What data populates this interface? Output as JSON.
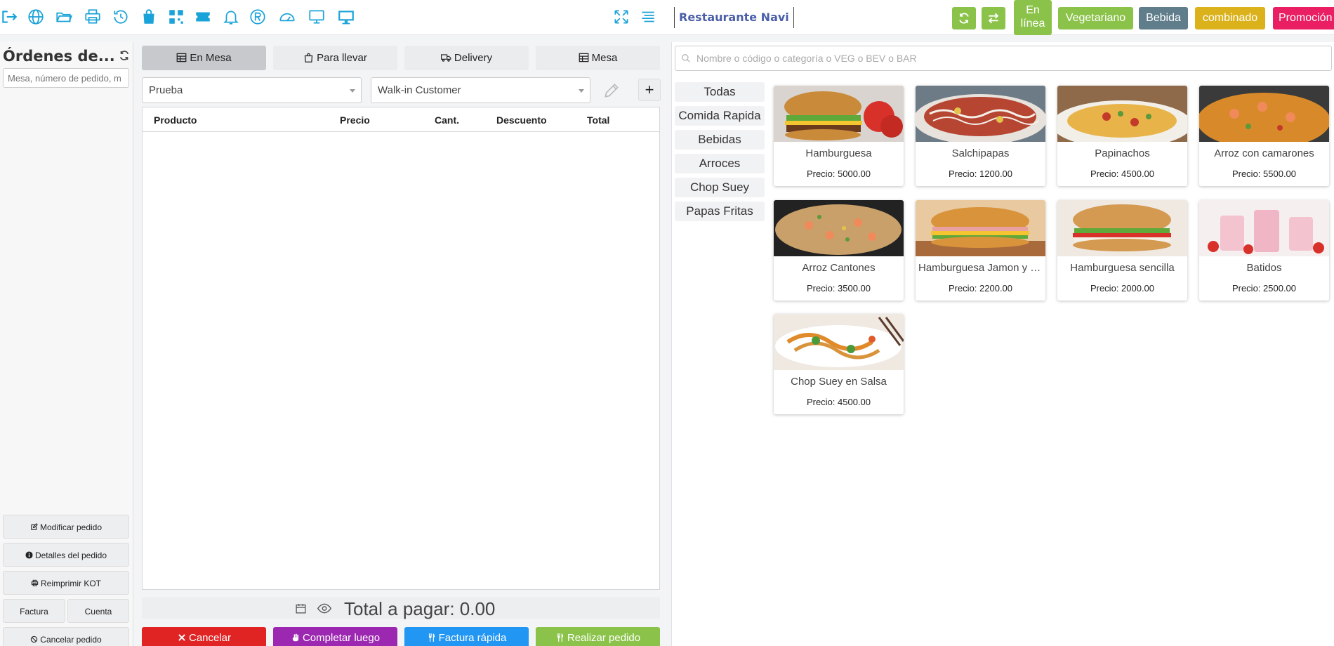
{
  "brand": "Restaurante Navi",
  "header": {
    "en_linea": "En línea",
    "vegetariano": "Vegetariano",
    "bebida": "Bebida",
    "combinado": "combinado",
    "promocion": "Promoción"
  },
  "colors": {
    "icon_blue": "#1aa3d8",
    "green": "#8bc34a",
    "slate": "#607d8b",
    "yellow": "#dbb21c",
    "pink": "#e91e63",
    "red": "#e02424",
    "purple": "#9c27b0",
    "blue": "#2196f3"
  },
  "orders": {
    "title": "Órdenes de...",
    "search_placeholder": "Mesa, número de pedido, m",
    "modify": "Modificar pedido",
    "details": "Detalles del pedido",
    "reprint": "Reimprimir KOT",
    "invoice": "Factura",
    "account": "Cuenta",
    "cancel_order": "Cancelar pedido"
  },
  "order": {
    "tabs": [
      "En Mesa",
      "Para llevar",
      "Delivery",
      "Mesa"
    ],
    "waiter": "Prueba",
    "customer": "Walk-in Customer",
    "add_label": "+",
    "columns": [
      "Producto",
      "Precio",
      "Cant.",
      "Descuento",
      "Total"
    ],
    "total_label": "Total a pagar: 0.00",
    "actions": {
      "cancel": "Cancelar",
      "later": "Completar luego",
      "quick": "Factura rápida",
      "place": "Realizar pedido"
    }
  },
  "products": {
    "search_placeholder": "Nombre o código o categoría o VEG o BEV o BAR",
    "categories": [
      "Todas",
      "Comida Rapida",
      "Bebidas",
      "Arroces",
      "Chop Suey",
      "Papas Fritas"
    ],
    "items": [
      {
        "name": "Hamburguesa",
        "price": "Precio: 5000.00"
      },
      {
        "name": "Salchipapas",
        "price": "Precio: 1200.00"
      },
      {
        "name": "Papinachos",
        "price": "Precio: 4500.00"
      },
      {
        "name": "Arroz con camarones",
        "price": "Precio: 5500.00"
      },
      {
        "name": "Arroz Cantones",
        "price": "Precio: 3500.00"
      },
      {
        "name": "Hamburguesa Jamon y Queso",
        "price": "Precio: 2200.00"
      },
      {
        "name": "Hamburguesa sencilla",
        "price": "Precio: 2000.00"
      },
      {
        "name": "Batidos",
        "price": "Precio: 2500.00"
      },
      {
        "name": "Chop Suey en Salsa",
        "price": "Precio: 4500.00"
      }
    ]
  }
}
